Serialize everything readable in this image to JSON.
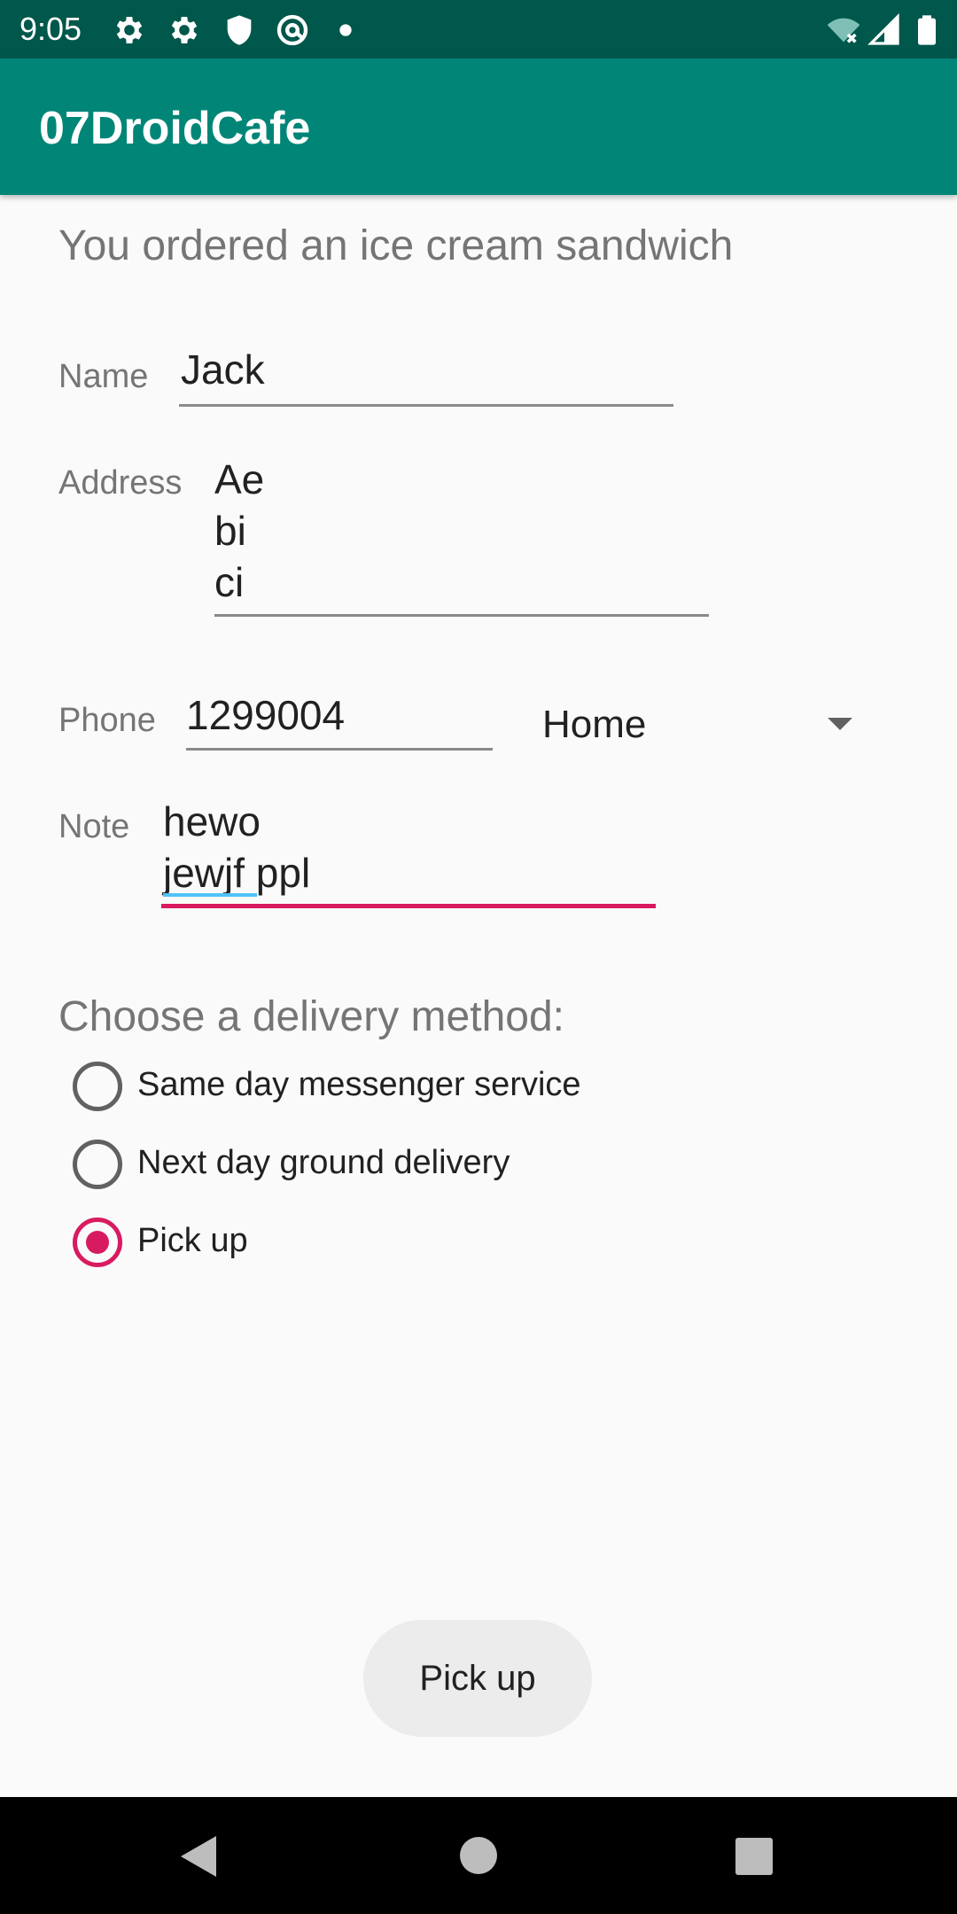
{
  "status_bar": {
    "time": "9:05",
    "icons": [
      "gear-icon",
      "gear-icon",
      "shield-icon",
      "at-sign-icon",
      "dot-icon",
      "wifi-off-icon",
      "cell-signal-icon",
      "battery-icon"
    ]
  },
  "app_bar": {
    "title": "07DroidCafe"
  },
  "order": {
    "message": "You ordered an ice cream sandwich"
  },
  "form": {
    "name_label": "Name",
    "name_value": "Jack",
    "address_label": "Address",
    "address_lines": [
      "Ae",
      "bi",
      "ci"
    ],
    "phone_label": "Phone",
    "phone_value": "1299004",
    "phone_type": "Home",
    "note_label": "Note",
    "note_lines": [
      "hewo",
      "jewjf ppl"
    ]
  },
  "delivery": {
    "heading": "Choose a delivery method:",
    "options": [
      {
        "label": "Same day messenger service",
        "checked": false
      },
      {
        "label": "Next day ground delivery",
        "checked": false
      },
      {
        "label": "Pick up",
        "checked": true
      }
    ]
  },
  "action_button": {
    "label": "Pick up"
  },
  "colors": {
    "status_bar": "#00574b",
    "app_bar": "#008577",
    "accent": "#d81b60",
    "background": "#fafafa"
  }
}
